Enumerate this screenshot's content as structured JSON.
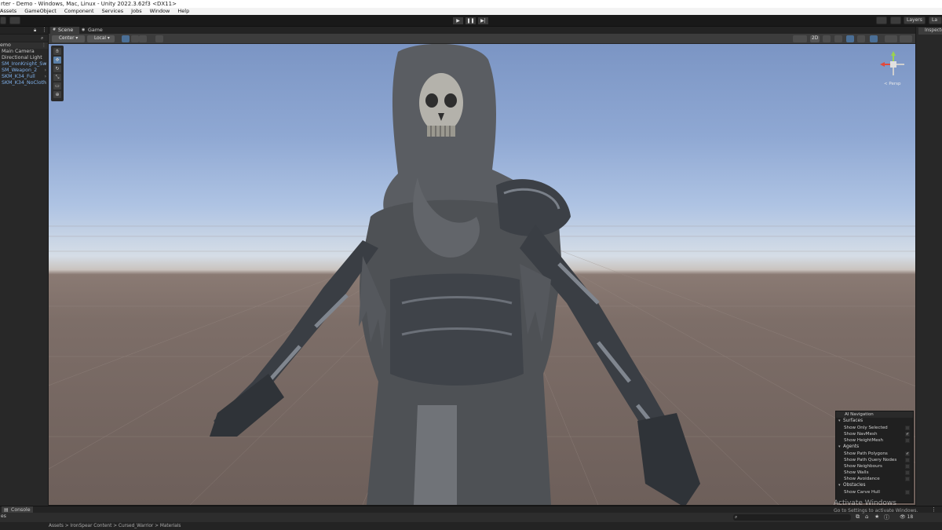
{
  "window": {
    "title": "rter - Demo - Windows, Mac, Linux - Unity 2022.3.62f3 <DX11>"
  },
  "menu": [
    "Assets",
    "GameObject",
    "Component",
    "Services",
    "Jobs",
    "Window",
    "Help"
  ],
  "toolbar": {
    "layers_label": "Layers",
    "layout_label": "La"
  },
  "hierarchy": {
    "root": "emo",
    "items": [
      {
        "label": "Main Camera",
        "blue": false
      },
      {
        "label": "Directional Light",
        "blue": false
      },
      {
        "label": "SM_IronKnight_Sw",
        "blue": true
      },
      {
        "label": "SM_Weapon_2",
        "blue": true
      },
      {
        "label": "SKM_K34_Full",
        "blue": true
      },
      {
        "label": "SKM_K34_NoCloth",
        "blue": true
      }
    ]
  },
  "scene": {
    "tabs": [
      "Scene",
      "Game"
    ],
    "pivot_label": "Center",
    "space_label": "Local",
    "view_2d_label": "2D",
    "gizmo_label": "< Persp"
  },
  "inspector": {
    "tab_label": "Inspecto"
  },
  "ai_navigation": {
    "title": "AI Navigation",
    "sections": [
      {
        "name": "Surfaces",
        "rows": [
          {
            "label": "Show Only Selected",
            "checked": false
          },
          {
            "label": "Show NavMesh",
            "checked": true
          },
          {
            "label": "Show HeightMesh",
            "checked": false
          }
        ]
      },
      {
        "name": "Agents",
        "rows": [
          {
            "label": "Show Path Polygons",
            "checked": true
          },
          {
            "label": "Show Path Query Nodes",
            "checked": false
          },
          {
            "label": "Show Neighbours",
            "checked": false
          },
          {
            "label": "Show Walls",
            "checked": false
          },
          {
            "label": "Show Avoidance",
            "checked": false
          }
        ]
      },
      {
        "name": "Obstacles",
        "rows": [
          {
            "label": "Show Carve Hull",
            "checked": false
          }
        ]
      }
    ]
  },
  "bottom": {
    "console_tab": "Console",
    "left_label": "es",
    "breadcrumb": "Assets > IronSpear Content > Cursed_Warrior > Materials",
    "count": "18"
  },
  "watermark": {
    "line1": "Activate Windows",
    "line2": "Go to Settings to activate Windows."
  },
  "colors": {
    "accent": "#4b6f96",
    "hierarchy_prefab_text": "#7fb0ea",
    "sky_top": "#7b95c4",
    "ground": "#7d6e68"
  }
}
